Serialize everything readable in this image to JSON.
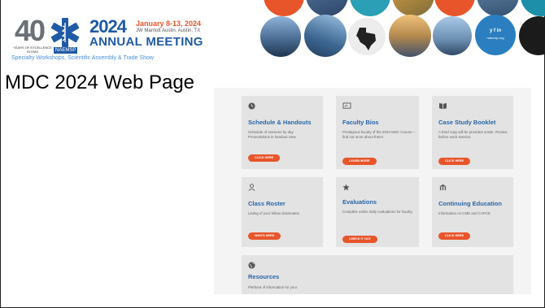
{
  "header": {
    "logo_40": "40",
    "logo_years": "YEARS OF EXCELLENCE IN EMS",
    "logo_org": "NAEMSP",
    "year": "2024",
    "dates": "January 8-13, 2024",
    "venue": "JW Marriott Austin, Austin, TX",
    "annual_meeting": "ANNUAL MEETING",
    "tagline": "Specialty Workshops, Scientific Assembly & Trade Show",
    "social_line": "y f in",
    "social_site": "naemsp.org"
  },
  "slide": {
    "title": "MDC 2024 Web Page"
  },
  "cards": [
    {
      "icon": "clock-icon",
      "glyph": "●",
      "title": "Schedule & Handouts",
      "desc": "Schedule of sessions by day\nPresentations in handout view",
      "button": "CLICK HERE"
    },
    {
      "icon": "presentation-icon",
      "glyph": "⊡",
      "title": "Faculty Bios",
      "desc": "Prestigious faculty of the 2024 MDC Course – find out more about them!",
      "button": "LEARN MORE"
    },
    {
      "icon": "book-icon",
      "glyph": "▮▮",
      "title": "Case Study Booklet",
      "desc": "A hard copy will be provided onsite. Review before each session.",
      "button": "CLICK HERE"
    },
    {
      "icon": "user-icon",
      "glyph": "♙",
      "title": "Class Roster",
      "desc": "Listing of your fellow classmates",
      "button": "WHO'S HERE"
    },
    {
      "icon": "star-icon",
      "glyph": "★",
      "title": "Evaluations",
      "desc": "Complete online daily evaluations for faculty.",
      "button": "CHECK IT OUT"
    },
    {
      "icon": "school-icon",
      "glyph": "⌂",
      "title": "Continuing Education",
      "desc": "Information on CME and CAPCE",
      "button": "CLICK HERE"
    },
    {
      "icon": "globe-icon",
      "glyph": "◉",
      "title": "Resources",
      "desc": "Plethora of information for you!",
      "button": ""
    }
  ],
  "colors": {
    "accent_orange": "#e8552b",
    "brand_blue": "#1f5aa6",
    "title_blue": "#2866a8",
    "card_bg": "#e3e3e3"
  }
}
